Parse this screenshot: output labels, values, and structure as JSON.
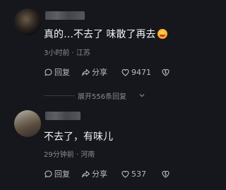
{
  "comments": [
    {
      "text": "真的…不去了 味散了再去",
      "emoji": "grinning-face-emoji",
      "meta": "3小时前 · 江苏",
      "reply_label": "回复",
      "share_label": "分享",
      "like_count": "9471",
      "expand_label": "展开556条回复"
    },
    {
      "text": "不去了，有味儿",
      "meta": "29分钟前 · 河南",
      "reply_label": "回复",
      "share_label": "分享",
      "like_count": "537"
    }
  ],
  "colors": {
    "background": "#16171c",
    "text": "#f2f2f5",
    "muted": "#8a8b91",
    "action": "#b9bac0"
  }
}
